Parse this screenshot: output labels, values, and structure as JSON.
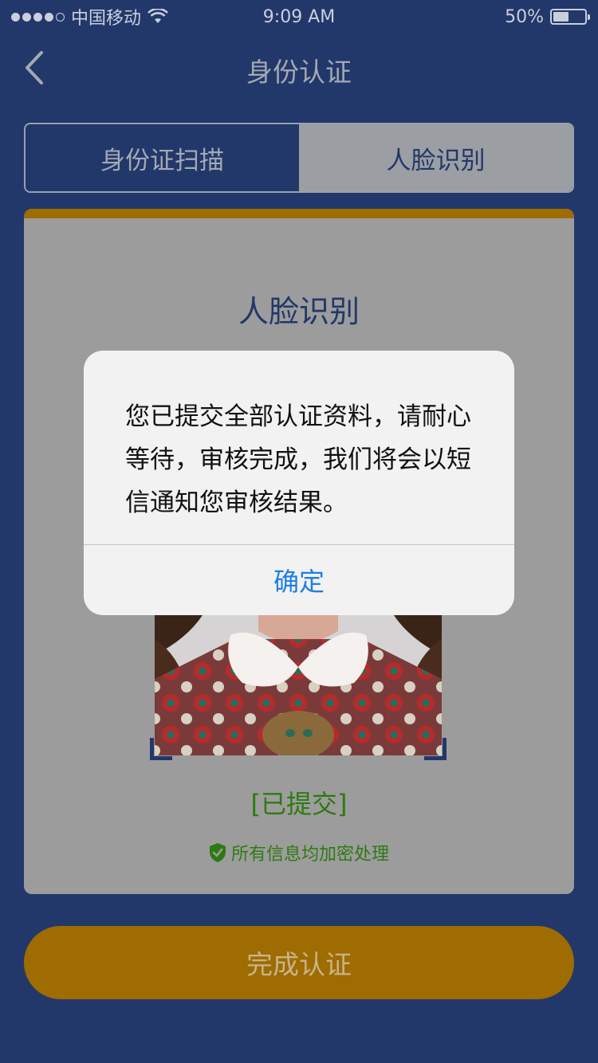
{
  "status_bar": {
    "carrier": "中国移动",
    "time": "9:09 AM",
    "battery": "50%",
    "battery_level": 0.5
  },
  "nav": {
    "title": "身份认证",
    "back_icon": "chevron-left-icon"
  },
  "tabs": [
    {
      "label": "身份证扫描"
    },
    {
      "label": "人脸识别"
    }
  ],
  "card": {
    "title": "人脸识别",
    "status": "[已提交]",
    "secure_note": "所有信息均加密处理"
  },
  "complete_button": {
    "label": "完成认证"
  },
  "alert": {
    "message": "您已提交全部认证资料，请耐心等待，审核完成，我们将会以短信通知您审核结果。",
    "ok_label": "确定"
  },
  "colors": {
    "background": "#22386a",
    "accent": "#9e6c00",
    "success": "#2e7a12",
    "link": "#1e7ee3"
  }
}
